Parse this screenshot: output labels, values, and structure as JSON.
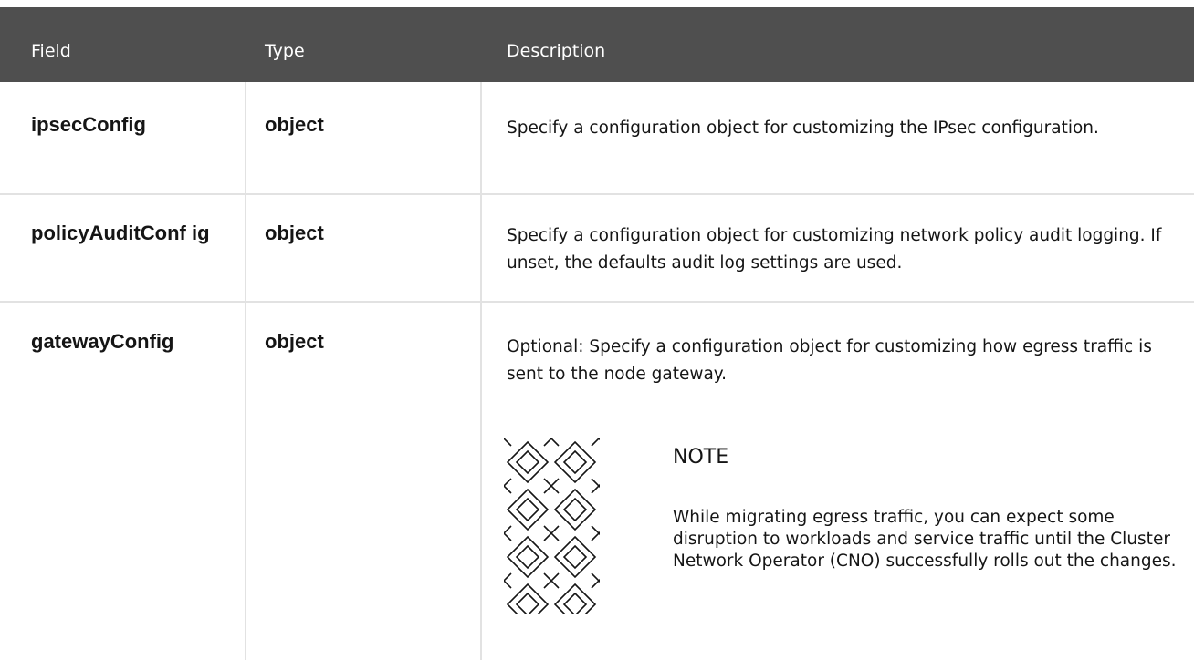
{
  "header": {
    "field": "Field",
    "type": "Type",
    "description": "Description"
  },
  "rows": [
    {
      "field": "ipsecConfig",
      "type": "object",
      "description": "Specify a configuration object for customizing the IPsec configuration."
    },
    {
      "field": "policyAuditConf ig",
      "type": "object",
      "description": "Specify a configuration object for customizing network policy audit logging. If unset, the defaults audit log settings are used."
    },
    {
      "field": "gatewayConfig",
      "type": "object",
      "description": "Optional: Specify a configuration object for customizing how egress traffic is sent to the node gateway.",
      "note": {
        "title": "NOTE",
        "body": "While migrating egress traffic, you can expect some disruption to workloads and service traffic until the Cluster Network Operator (CNO) successfully rolls out the changes.",
        "icon": "note-pattern-icon"
      }
    }
  ],
  "colors": {
    "header_bg": "#4f4f4f",
    "header_text": "#ffffff",
    "grid": "#e2e2e2",
    "text": "#151515"
  }
}
